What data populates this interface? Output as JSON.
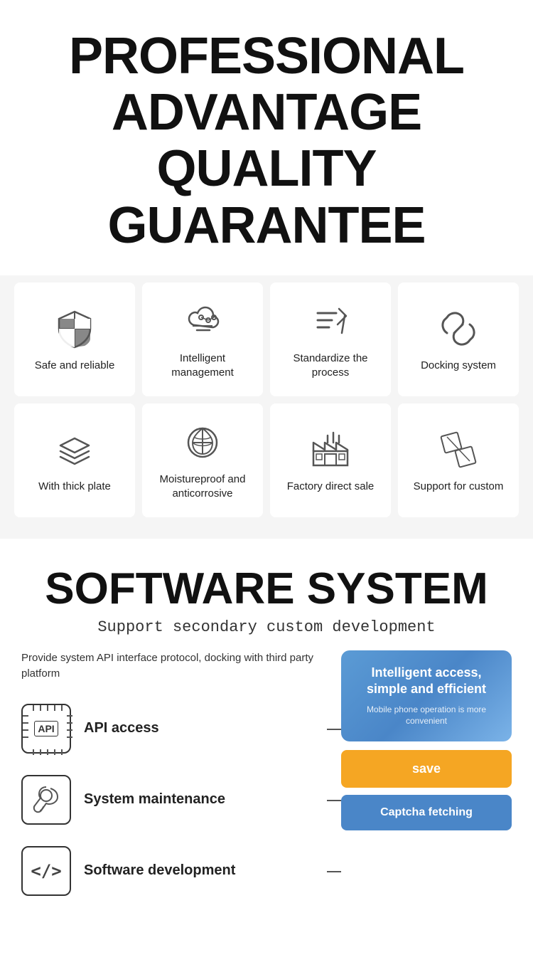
{
  "header": {
    "line1": "PROFESSIONAL",
    "line2": "ADVANTAGE",
    "line3": "QUALITY GUARANTEE"
  },
  "grid_row1": [
    {
      "icon": "shield",
      "label": "Safe and reliable"
    },
    {
      "icon": "cloud",
      "label": "Intelligent management"
    },
    {
      "icon": "process",
      "label": "Standardize the process"
    },
    {
      "icon": "link",
      "label": "Docking system"
    }
  ],
  "grid_row2": [
    {
      "icon": "layers",
      "label": "With thick plate"
    },
    {
      "icon": "leaf",
      "label": "Moistureproof and anticorrosive"
    },
    {
      "icon": "factory",
      "label": "Factory direct sale"
    },
    {
      "icon": "custom",
      "label": "Support for custom"
    }
  ],
  "software": {
    "title": "SOFTWARE SYSTEM",
    "subtitle": "Support secondary custom development",
    "desc": "Provide system API interface protocol, docking with third party platform",
    "items": [
      {
        "icon": "api",
        "label": "API access"
      },
      {
        "icon": "maintenance",
        "label": "System maintenance"
      },
      {
        "icon": "code",
        "label": "Software development"
      }
    ],
    "phone_card": {
      "title": "Intelligent access, simple and efficient",
      "subtitle": "Mobile phone operation is more convenient"
    },
    "btn_save": "save",
    "btn_captcha": "Captcha fetching"
  }
}
